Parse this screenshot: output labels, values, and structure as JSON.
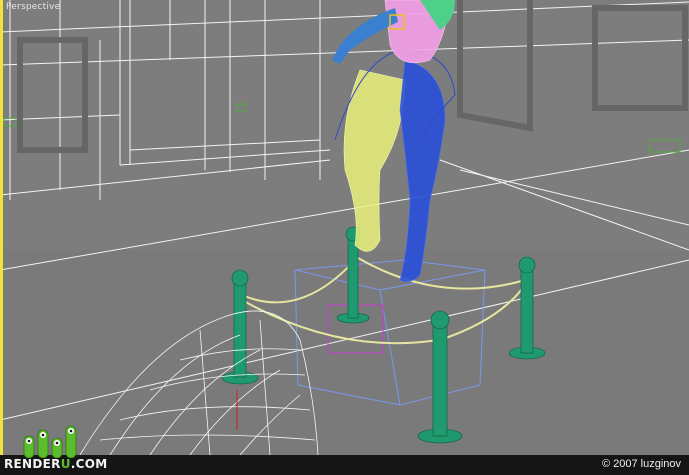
{
  "viewport": {
    "label": "Perspective",
    "active_border_color": "#f2e33a",
    "background_color": "#7c7c7c"
  },
  "scene_colors": {
    "room_wireframe": "#ffffff",
    "leg_left": "#e7f07a",
    "leg_right": "#2a4fd8",
    "torso": "#f4a0e8",
    "arm": "#3a7fd0",
    "stanchion": "#1f9a6e",
    "rope": "#e8e8a0",
    "pedestal_box": "#6a8fe8",
    "selection": "#c83ad0"
  },
  "footer": {
    "brand_prefix": "RENDER",
    "brand_accent": "U",
    "brand_suffix": ".COM",
    "copyright": "© 2007 luzginov"
  }
}
